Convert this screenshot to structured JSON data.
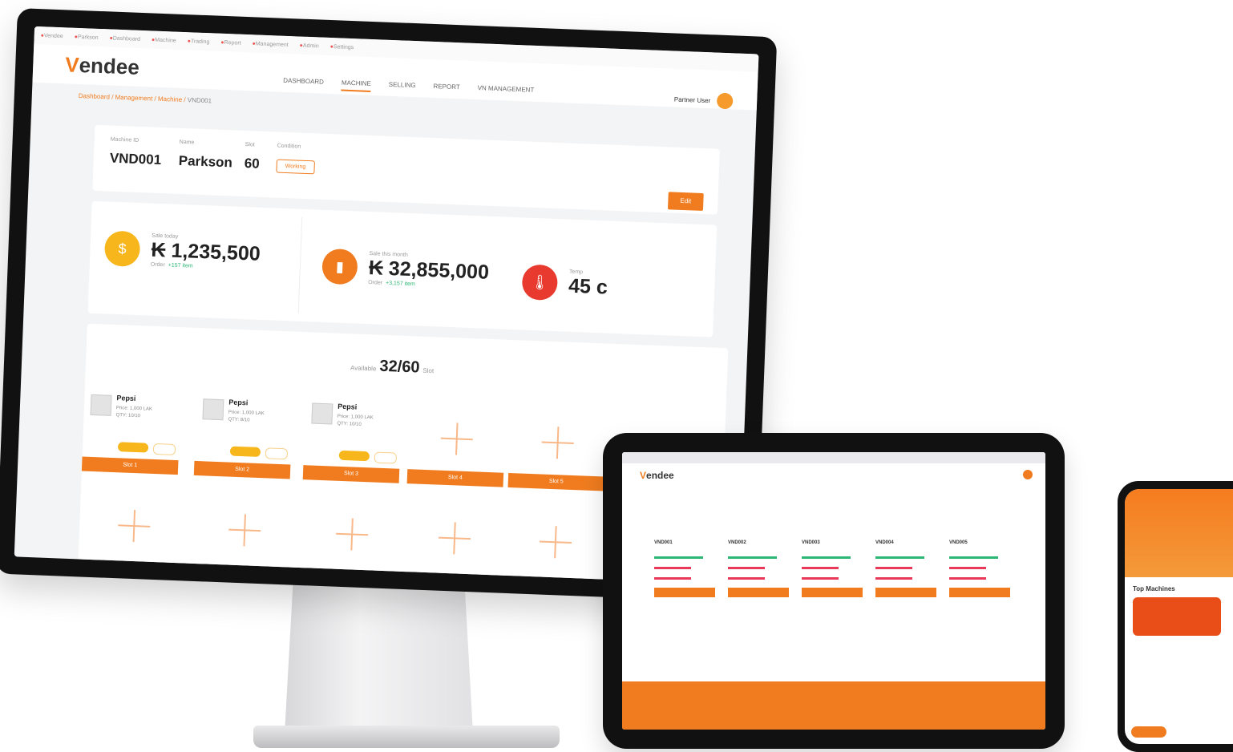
{
  "browser": {
    "bookmarks": [
      "Vendee",
      "Parkson",
      "Dashboard",
      "Machine",
      "Trading",
      "Report",
      "Management",
      "Admin",
      "Settings"
    ]
  },
  "app": {
    "logo_prefix": "V",
    "logo_rest": "endee",
    "nav": [
      "DASHBOARD",
      "MACHINE",
      "SELLING",
      "REPORT",
      "VN MANAGEMENT"
    ],
    "user_name": "Partner User",
    "breadcrumb": {
      "path": "Dashboard / Management / Machine / ",
      "current": "VND001"
    }
  },
  "machine": {
    "id_label": "Machine ID",
    "id": "VND001",
    "name_label": "Name",
    "name": "Parkson",
    "slot_label": "Slot",
    "slots": "60",
    "condition_label": "Condition",
    "condition": "Working",
    "edit_label": "Edit"
  },
  "stats": {
    "today_label": "Sale today",
    "today_value": "₭ 1,235,500",
    "today_sub": "Order",
    "today_delta": "+157 item",
    "total_label": "Sale this month",
    "total_value": "₭ 32,855,000",
    "total_sub": "Order",
    "total_delta": "+3,157 item",
    "temp_label": "Temp",
    "temp_value": "45 c"
  },
  "slots": {
    "available_label": "Available",
    "available_value": "32/60",
    "unit": "Slot",
    "items": [
      {
        "name": "Pepsi",
        "meta": "Price: 1,000 LAK\nQTY: 10/10",
        "bar": "Slot 1"
      },
      {
        "name": "Pepsi",
        "meta": "Price: 1,000 LAK\nQTY: 8/10",
        "bar": "Slot 2"
      },
      {
        "name": "Pepsi",
        "meta": "Price: 1,000 LAK\nQTY: 10/10",
        "bar": "Slot 3"
      }
    ],
    "empty_bars": [
      "Slot 4",
      "Slot 5"
    ]
  },
  "tablet": {
    "logo_prefix": "V",
    "logo_rest": "endee",
    "columns": [
      "VND001",
      "VND002",
      "VND003",
      "VND004",
      "VND005"
    ]
  },
  "phone": {
    "section": "Top Machines"
  },
  "colors": {
    "brand": "#f07c1f",
    "accent_yellow": "#f7b61c",
    "green": "#2bb673",
    "red": "#e83a58"
  },
  "icons": {
    "today": "coin-icon",
    "total": "sales-icon",
    "temp": "thermometer-icon"
  }
}
